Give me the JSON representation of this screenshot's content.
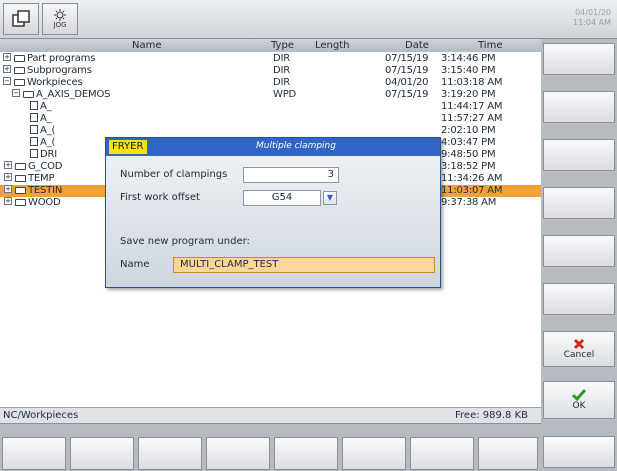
{
  "topbar": {
    "jog_label": "JOG",
    "date": "04/01/20",
    "time": "11:04 AM"
  },
  "table": {
    "headers": {
      "name": "Name",
      "type": "Type",
      "length": "Length",
      "date": "Date",
      "time": "Time"
    },
    "rows": [
      {
        "name": "Part programs",
        "type": "DIR",
        "length": "",
        "date": "07/15/19",
        "time": "3:14:46 PM"
      },
      {
        "name": "Subprograms",
        "type": "DIR",
        "length": "",
        "date": "07/15/19",
        "time": "3:15:40 PM"
      },
      {
        "name": "Workpieces",
        "type": "DIR",
        "length": "",
        "date": "04/01/20",
        "time": "11:03:18 AM"
      },
      {
        "name": "A_AXIS_DEMOS",
        "type": "WPD",
        "length": "",
        "date": "07/15/19",
        "time": "3:19:20 PM"
      },
      {
        "name": "A_",
        "type": "",
        "length": "",
        "date": "",
        "time": "11:44:17 AM"
      },
      {
        "name": "A_",
        "type": "",
        "length": "",
        "date": "",
        "time": "11:57:27 AM"
      },
      {
        "name": "A_(",
        "type": "",
        "length": "",
        "date": "",
        "time": "2:02:10 PM"
      },
      {
        "name": "A_(",
        "type": "",
        "length": "",
        "date": "",
        "time": "4:03:47 PM"
      },
      {
        "name": "DRI",
        "type": "",
        "length": "",
        "date": "",
        "time": "9:48:50 PM"
      },
      {
        "name": "G_COD",
        "type": "",
        "length": "",
        "date": "",
        "time": "3:18:52 PM"
      },
      {
        "name": "TEMP",
        "type": "",
        "length": "",
        "date": "",
        "time": "11:34:26 AM"
      },
      {
        "name": "TESTIN",
        "type": "",
        "length": "",
        "date": "",
        "time": "11:03:07 AM"
      },
      {
        "name": "WOOD",
        "type": "",
        "length": "",
        "date": "",
        "time": "9:37:38 AM"
      }
    ]
  },
  "status": {
    "path": "NC/Workpieces",
    "free": "Free: 989.8 KB"
  },
  "dialog": {
    "mode": "FRYER",
    "title": "Multiple clamping",
    "num_clampings_label": "Number of clampings",
    "num_clampings_value": "3",
    "work_offset_label": "First work offset",
    "work_offset_value": "G54",
    "save_label": "Save new program under:",
    "name_label": "Name",
    "name_value": "MULTI_CLAMP_TEST"
  },
  "softkeys": {
    "cancel_label": "Cancel",
    "ok_label": "OK"
  },
  "colors": {
    "selection": "#f3a333",
    "dialog_header": "#2f66c6",
    "mode_badge": "#f7e20a",
    "cancel": "#d0281e",
    "ok": "#2e9a2e"
  },
  "icons": [
    "window-switch-icon",
    "jog-icon",
    "folder-icon",
    "document-icon",
    "cancel-x-icon",
    "ok-check-icon",
    "dropdown-arrow-icon"
  ]
}
